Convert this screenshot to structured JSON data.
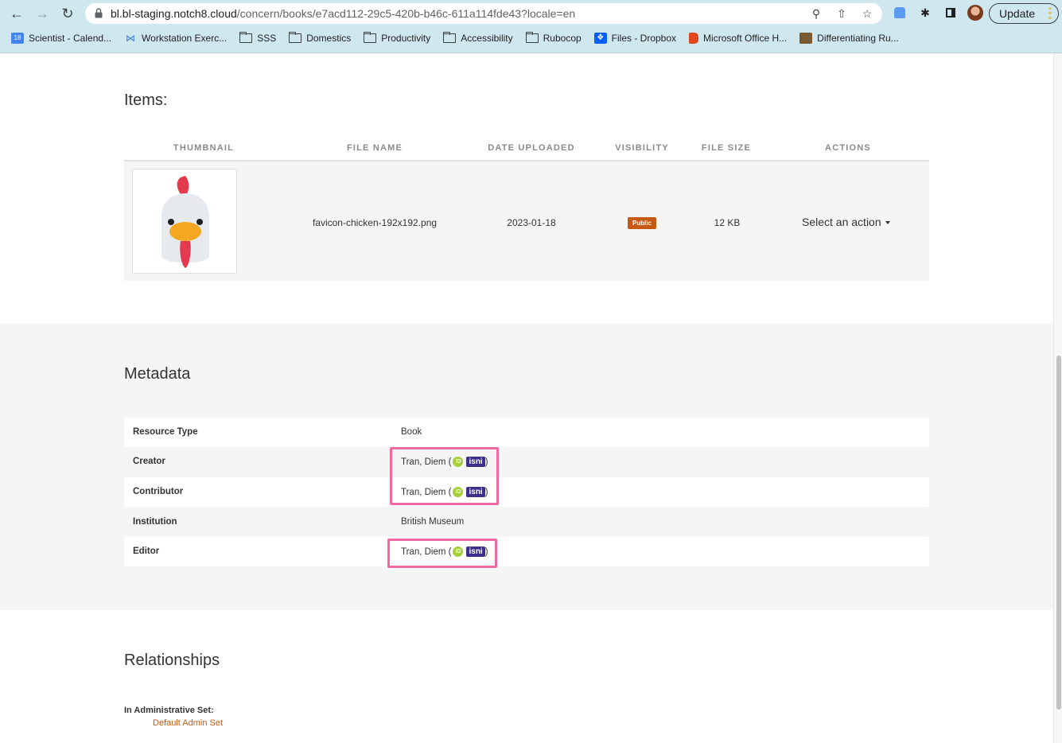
{
  "browser": {
    "url_host": "bl.bl-staging.notch8.cloud",
    "url_path": "/concern/books/e7acd112-29c5-420b-b46c-611a114fde43?locale=en",
    "update_label": "Update",
    "bookmarks": [
      {
        "label": "Scientist - Calend...",
        "icon": "calendar-icon"
      },
      {
        "label": "Workstation Exerc...",
        "icon": "workstation-icon"
      },
      {
        "label": "SSS",
        "icon": "folder-icon"
      },
      {
        "label": "Domestics",
        "icon": "folder-icon"
      },
      {
        "label": "Productivity",
        "icon": "folder-icon"
      },
      {
        "label": "Accessibility",
        "icon": "folder-icon"
      },
      {
        "label": "Rubocop",
        "icon": "folder-icon"
      },
      {
        "label": "Files - Dropbox",
        "icon": "dropbox-icon"
      },
      {
        "label": "Microsoft Office H...",
        "icon": "office-icon"
      },
      {
        "label": "Differentiating Ru...",
        "icon": "book-icon"
      }
    ]
  },
  "items": {
    "heading": "Items:",
    "columns": [
      "THUMBNAIL",
      "FILE NAME",
      "DATE UPLOADED",
      "VISIBILITY",
      "FILE SIZE",
      "ACTIONS"
    ],
    "rows": [
      {
        "file_name": "favicon-chicken-192x192.png",
        "date_uploaded": "2023-01-18",
        "visibility": "Public",
        "file_size": "12 KB",
        "action": "Select an action"
      }
    ]
  },
  "metadata": {
    "heading": "Metadata",
    "rows": [
      {
        "label": "Resource Type",
        "value": "Book"
      },
      {
        "label": "Creator",
        "value": "Tran, Diem (",
        "orcid": "iD",
        "isni": "isni",
        "close": ")"
      },
      {
        "label": "Contributor",
        "value": "Tran, Diem (",
        "orcid": "iD",
        "isni": "isni",
        "close": ")"
      },
      {
        "label": "Institution",
        "value": "British Museum"
      },
      {
        "label": "Editor",
        "value": "Tran, Diem (",
        "orcid": "iD",
        "isni": "isni",
        "close": ")"
      }
    ]
  },
  "relationships": {
    "heading": "Relationships",
    "admin_set_label": "In Administrative Set:",
    "admin_set_link": "Default Admin Set"
  },
  "colors": {
    "accent": "#c75a12",
    "highlight": "#f06aa0",
    "chrome": "#cfe8ef",
    "isni": "#3a2f8a",
    "orcid": "#a6ce39"
  }
}
